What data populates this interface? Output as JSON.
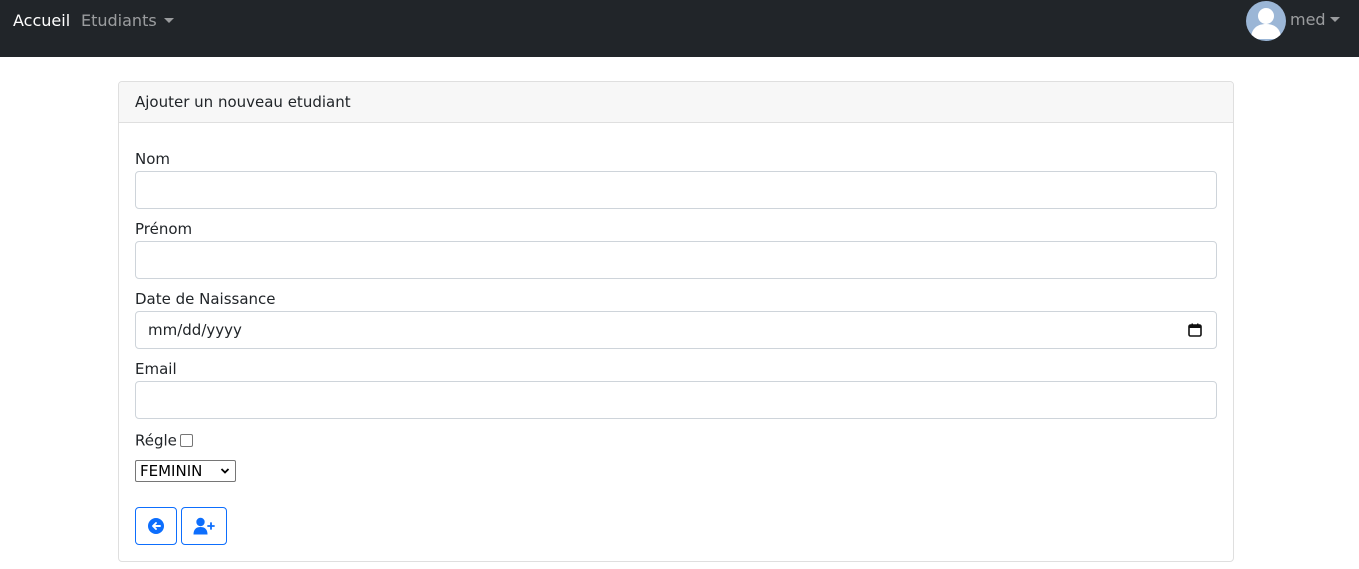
{
  "navbar": {
    "brand": "Accueil",
    "dropdown_label": "Etudiants",
    "user_name": "med"
  },
  "card": {
    "title": "Ajouter un nouveau etudiant"
  },
  "form": {
    "nom_label": "Nom",
    "nom_value": "",
    "prenom_label": "Prénom",
    "prenom_value": "",
    "date_label": "Date de Naissance",
    "date_placeholder": "mm/dd/yyyy",
    "email_label": "Email",
    "email_value": "",
    "regle_label": "Régle",
    "regle_checked": false,
    "genre_selected": "FEMININ"
  },
  "icons": {
    "back_button": "circle-arrow-left-icon",
    "add_button": "user-plus-icon",
    "calendar": "calendar-icon",
    "avatar": "user-avatar-icon"
  },
  "colors": {
    "navbar_bg": "#212529",
    "primary": "#0d6efd",
    "avatar_bg": "#9bb6d6",
    "card_header_bg": "#f7f7f7"
  }
}
